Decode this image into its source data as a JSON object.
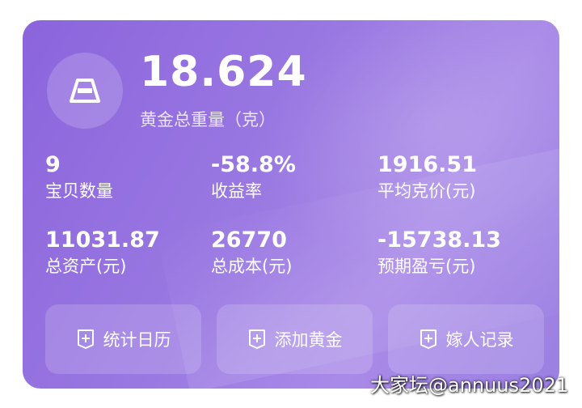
{
  "summary": {
    "total_weight": "18.624",
    "total_weight_label": "黄金总重量（克）",
    "icon": "gold-bar-icon"
  },
  "stats": [
    {
      "value": "9",
      "label": "宝贝数量"
    },
    {
      "value": "-58.8%",
      "label": "收益率"
    },
    {
      "value": "1916.51",
      "label": "平均克价(元)"
    },
    {
      "value": "11031.87",
      "label": "总资产(元)"
    },
    {
      "value": "26770",
      "label": "总成本(元)"
    },
    {
      "value": "-15738.13",
      "label": "预期盈亏(元)"
    }
  ],
  "actions": [
    {
      "label": "统计日历",
      "icon": "plus-tag-icon"
    },
    {
      "label": "添加黄金",
      "icon": "plus-tag-icon"
    },
    {
      "label": "嫁人记录",
      "icon": "plus-tag-icon"
    }
  ],
  "watermark": "大家坛@annuus2021",
  "colors": {
    "card_gradient_start": "#8b64dc",
    "card_gradient_end": "#a98ae8",
    "text": "#ffffff"
  }
}
